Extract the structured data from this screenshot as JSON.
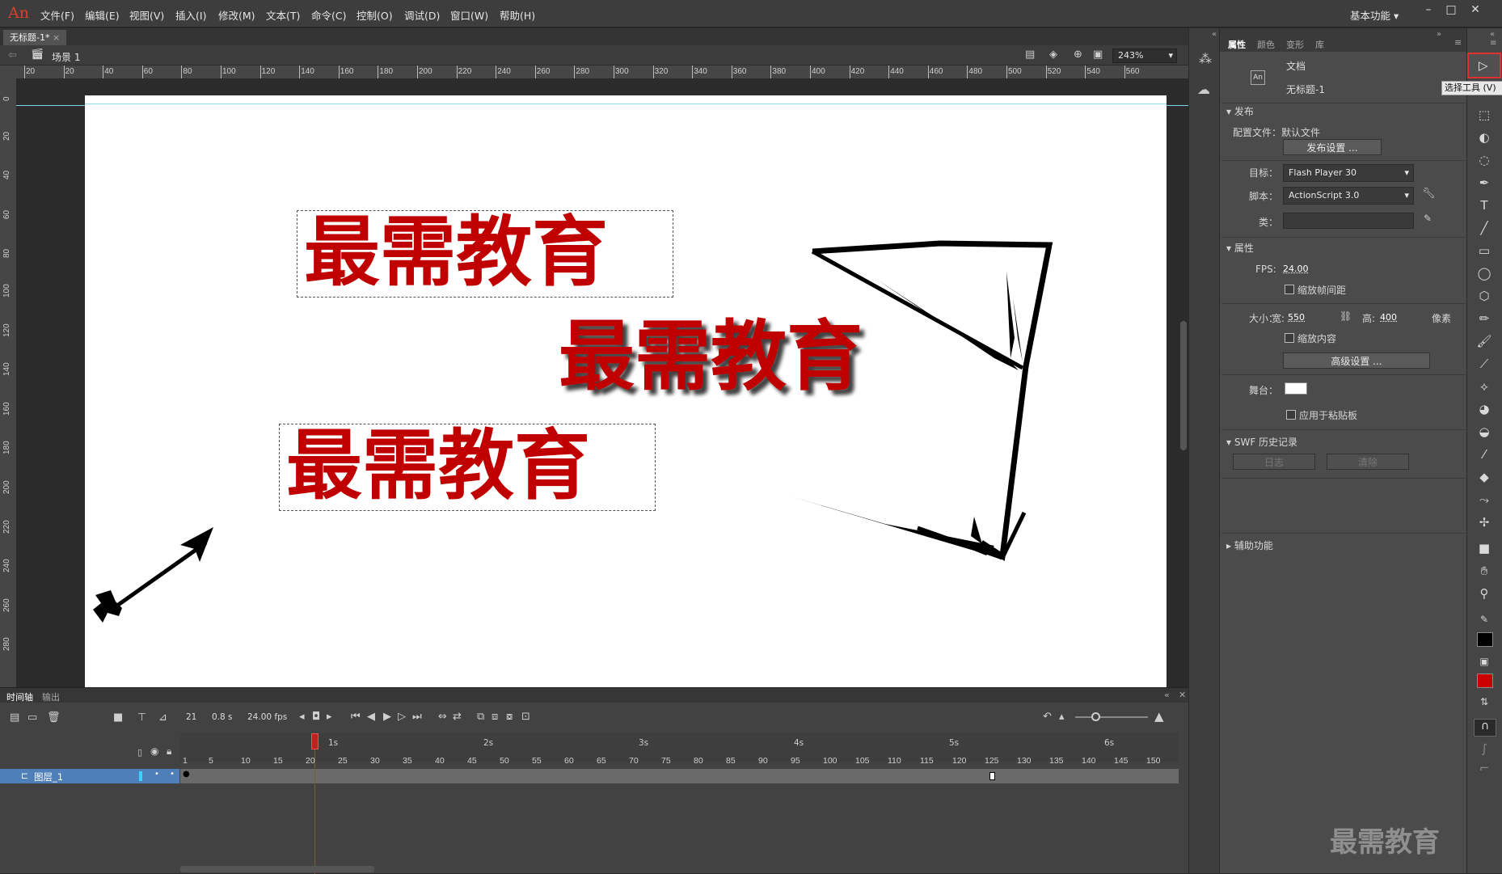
{
  "app": {
    "logo": "An",
    "workspace": "基本功能"
  },
  "menu": [
    "文件(F)",
    "编辑(E)",
    "视图(V)",
    "插入(I)",
    "修改(M)",
    "文本(T)",
    "命令(C)",
    "控制(O)",
    "调试(D)",
    "窗口(W)",
    "帮助(H)"
  ],
  "document": {
    "tab_title": "无标题-1*",
    "scene": "场景 1",
    "zoom": "243%"
  },
  "ruler": {
    "top": [
      "20",
      "20",
      "40",
      "60",
      "80",
      "100",
      "120",
      "140",
      "160",
      "180",
      "200",
      "220",
      "240",
      "260",
      "280",
      "300",
      "320",
      "340",
      "360",
      "380",
      "400",
      "420",
      "440",
      "460",
      "480",
      "500",
      "520",
      "540",
      "560"
    ],
    "left": [
      "0",
      "20",
      "40",
      "60",
      "80",
      "100",
      "120",
      "140",
      "160",
      "180",
      "200",
      "220",
      "240",
      "260",
      "280"
    ]
  },
  "stage": {
    "text_block_1": "最需教育",
    "text_block_2": "最需教育",
    "text_block_3": "最需教育",
    "text_color": "#cc0000"
  },
  "timeline": {
    "tabs": [
      "时间轴",
      "输出"
    ],
    "current_frame": "21",
    "time": "0.8 s",
    "fps": "24.00 fps",
    "layer_name": "图层_1",
    "seconds": [
      "1s",
      "2s",
      "3s",
      "4s",
      "5s",
      "6s"
    ],
    "frame_labels": [
      "1",
      "5",
      "10",
      "15",
      "20",
      "25",
      "30",
      "35",
      "40",
      "45",
      "50",
      "55",
      "60",
      "65",
      "70",
      "75",
      "80",
      "85",
      "90",
      "95",
      "100",
      "105",
      "110",
      "115",
      "120",
      "125",
      "130",
      "135",
      "140",
      "145",
      "150"
    ]
  },
  "properties": {
    "tabs": [
      "属性",
      "颜色",
      "变形",
      "库"
    ],
    "doc_type": "文档",
    "doc_name": "无标题-1",
    "publish_section": "发布",
    "profile_label": "配置文件：",
    "profile_value": "默认文件",
    "publish_settings_btn": "发布设置 ...",
    "target_label": "目标：",
    "target_value": "Flash Player 30",
    "script_label": "脚本：",
    "script_value": "ActionScript 3.0",
    "class_label": "类：",
    "props_section": "属性",
    "fps_label": "FPS:",
    "fps_value": "24.00",
    "scale_spans": "缩放帧间距",
    "size_label": "大小：",
    "width_label": "宽:",
    "width_value": "550",
    "height_label": "高:",
    "height_value": "400",
    "unit": "像素",
    "scale_content": "缩放内容",
    "advanced_btn": "高级设置 ...",
    "stage_label": "舞台：",
    "apply_pasteboard": "应用于粘贴板",
    "swf_section": "SWF 历史记录",
    "log_btn": "日志",
    "clear_btn": "清除",
    "accessibility_section": "辅助功能"
  },
  "tools": {
    "tooltip": "选择工具 (V)"
  },
  "watermark": "最需教育"
}
